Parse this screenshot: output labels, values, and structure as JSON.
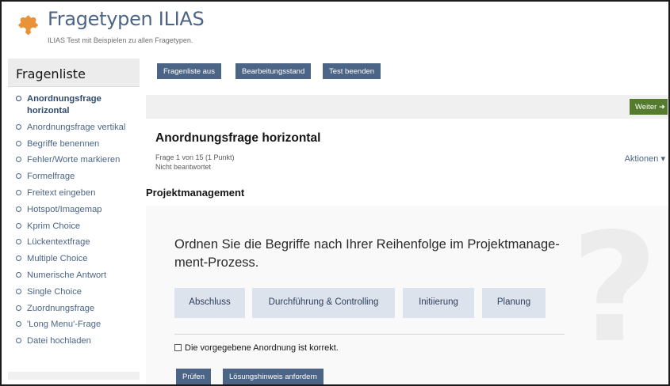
{
  "header": {
    "title": "Fragetypen ILIAS",
    "subtitle": "ILIAS Test mit Beispielen zu allen Fragetypen."
  },
  "sidebar": {
    "heading": "Fragenliste",
    "items": [
      {
        "label": "Anordnungsfrage horizontal",
        "active": true
      },
      {
        "label": "Anordnungsfrage vertikal"
      },
      {
        "label": "Begriffe benennen"
      },
      {
        "label": "Fehler/Worte markieren"
      },
      {
        "label": "Formelfrage"
      },
      {
        "label": "Freitext eingeben"
      },
      {
        "label": "Hotspot/Imagemap"
      },
      {
        "label": "Kprim Choice"
      },
      {
        "label": "Lückentextfrage"
      },
      {
        "label": "Multiple Choice"
      },
      {
        "label": "Numerische Antwort"
      },
      {
        "label": "Single Choice"
      },
      {
        "label": "Zuordnungsfrage"
      },
      {
        "label": "'Long Menu'-Frage"
      },
      {
        "label": "Datei hochladen"
      }
    ]
  },
  "toolbar": {
    "list_off": "Fragenliste aus",
    "progress": "Bearbeitungsstand",
    "finish": "Test beenden"
  },
  "nav": {
    "next": "Weiter"
  },
  "question": {
    "title": "Anordnungsfrage horizontal",
    "position": "Frage 1 von 15 (1 Punkt)",
    "status": "Nicht beantwortet",
    "actions": "Aktionen",
    "section": "Projektmanagement",
    "text_line1": "Ordnen Sie die Begriffe nach Ihrer Reihenfolge im Projektmanage-",
    "text_line2": "ment-Prozess.",
    "items": [
      "Abschluss",
      "Durchführung & Controlling",
      "Initiierung",
      "Planung"
    ],
    "checkbox_label": "Die vorgegebene Anordnung ist korrekt.",
    "check_btn": "Prüfen",
    "hint_btn": "Lösungshinweis anfordern"
  },
  "colors": {
    "primary": "#4c6586",
    "success": "#557b2e",
    "logo": "#e8923a"
  }
}
